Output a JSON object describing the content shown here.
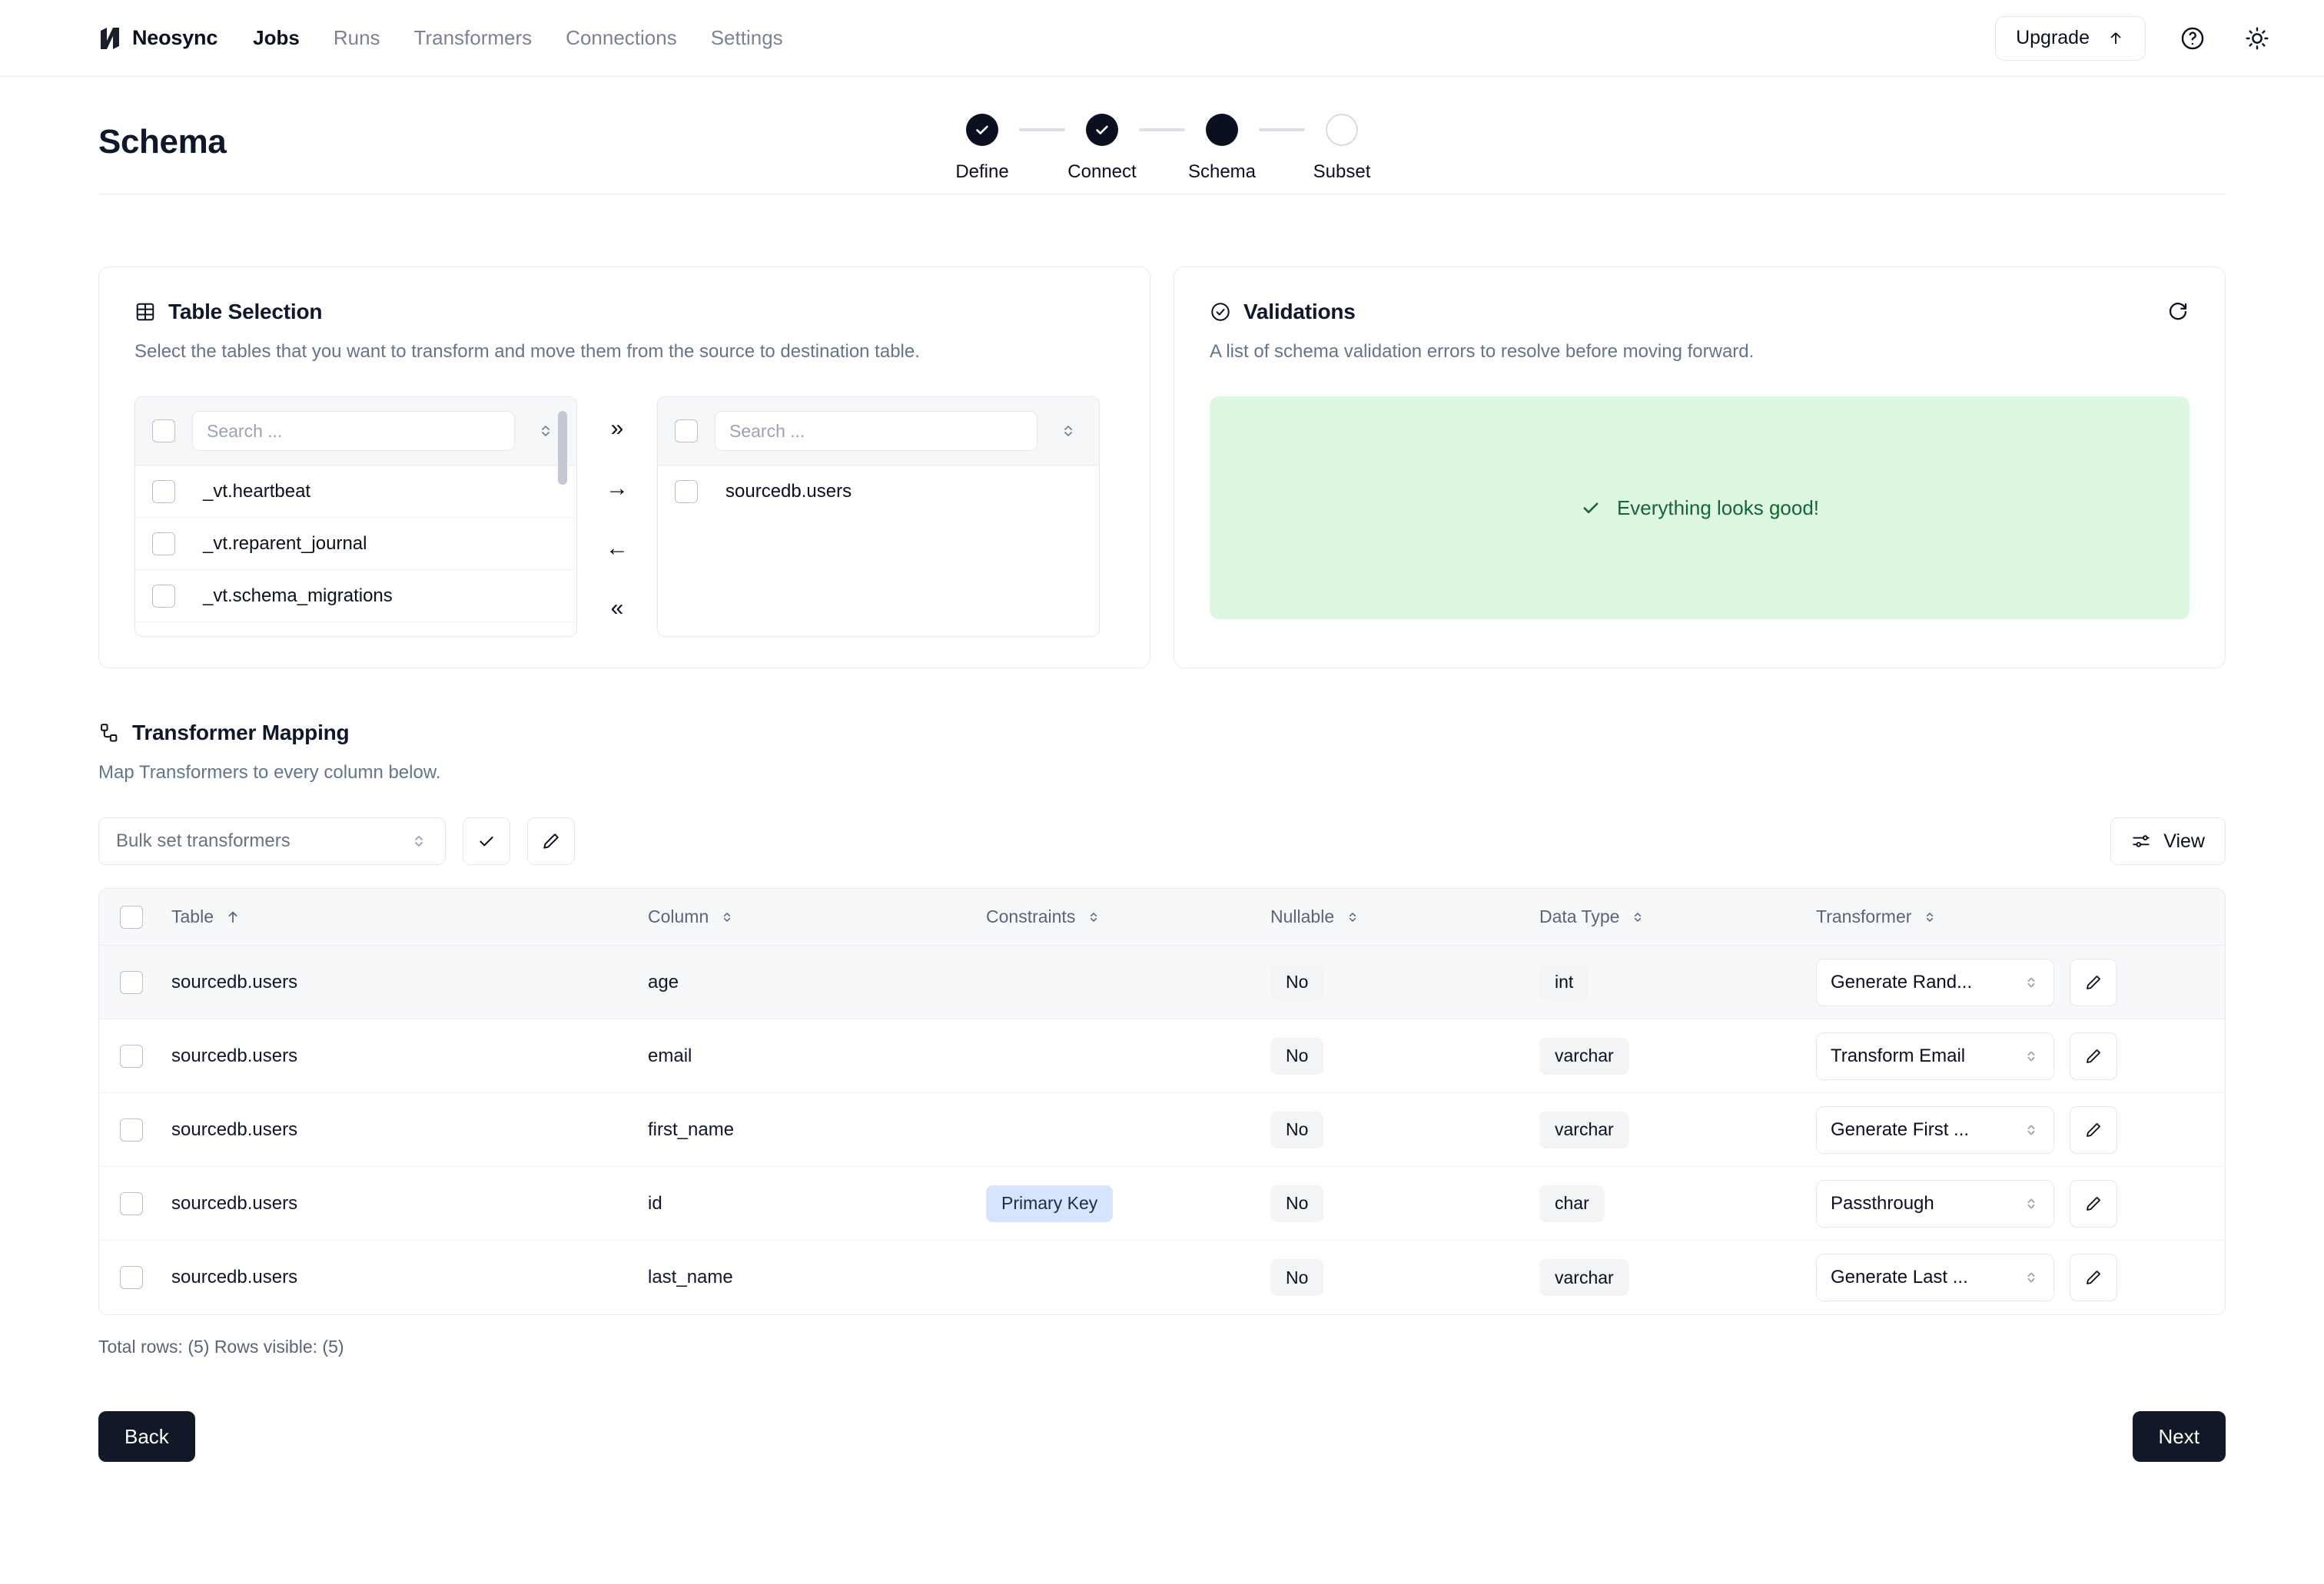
{
  "header": {
    "brand": "Neosync",
    "nav": [
      {
        "label": "Jobs",
        "active": true
      },
      {
        "label": "Runs",
        "active": false
      },
      {
        "label": "Transformers",
        "active": false
      },
      {
        "label": "Connections",
        "active": false
      },
      {
        "label": "Settings",
        "active": false
      }
    ],
    "upgrade_label": "Upgrade"
  },
  "page": {
    "title": "Schema",
    "steps": [
      {
        "label": "Define",
        "state": "complete"
      },
      {
        "label": "Connect",
        "state": "complete"
      },
      {
        "label": "Schema",
        "state": "current"
      },
      {
        "label": "Subset",
        "state": "pending"
      }
    ]
  },
  "table_selection": {
    "title": "Table Selection",
    "description": "Select the tables that you want to transform and move them from the source to destination table.",
    "search_placeholder": "Search ...",
    "source_items": [
      "_vt.heartbeat",
      "_vt.reparent_journal",
      "_vt.schema_migrations"
    ],
    "destination_items": [
      "sourcedb.users"
    ],
    "controls": [
      "»",
      "→",
      "←",
      "«"
    ]
  },
  "validations": {
    "title": "Validations",
    "description": "A list of schema validation errors to resolve before moving forward.",
    "status_text": "Everything looks good!"
  },
  "transformer_mapping": {
    "title": "Transformer Mapping",
    "description": "Map Transformers to every column below.",
    "bulk_label": "Bulk set transformers",
    "view_label": "View",
    "columns": [
      "Table",
      "Column",
      "Constraints",
      "Nullable",
      "Data Type",
      "Transformer"
    ],
    "rows": [
      {
        "table": "sourcedb.users",
        "column": "age",
        "constraints": "",
        "nullable": "No",
        "data_type": "int",
        "transformer": "Generate Rand..."
      },
      {
        "table": "sourcedb.users",
        "column": "email",
        "constraints": "",
        "nullable": "No",
        "data_type": "varchar",
        "transformer": "Transform Email"
      },
      {
        "table": "sourcedb.users",
        "column": "first_name",
        "constraints": "",
        "nullable": "No",
        "data_type": "varchar",
        "transformer": "Generate First ..."
      },
      {
        "table": "sourcedb.users",
        "column": "id",
        "constraints": "Primary Key",
        "nullable": "No",
        "data_type": "char",
        "transformer": "Passthrough"
      },
      {
        "table": "sourcedb.users",
        "column": "last_name",
        "constraints": "",
        "nullable": "No",
        "data_type": "varchar",
        "transformer": "Generate Last ..."
      }
    ],
    "row_count_text": "Total rows: (5) Rows visible: (5)"
  },
  "footer": {
    "back_label": "Back",
    "next_label": "Next"
  },
  "colors": {
    "accent_dark": "#111827",
    "success_bg": "#ddf7e3",
    "success_fg": "#166534",
    "pk_badge_bg": "#d6e4ff"
  }
}
